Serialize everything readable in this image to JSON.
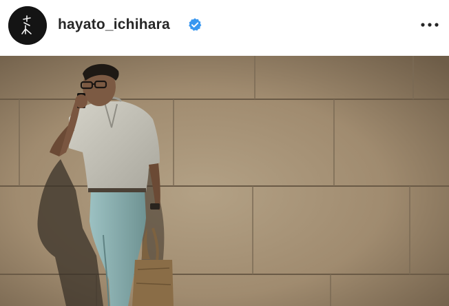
{
  "post_header": {
    "username": "hayato_ichihara",
    "verified": true,
    "avatar_icon": "calligraphy-logo-icon",
    "more_icon": "more-options-icon",
    "verified_icon": "verified-badge-icon",
    "colors": {
      "text": "#262626",
      "verified_blue": "#3897f0",
      "avatar_bg": "#141414"
    }
  },
  "post_image": {
    "description_icon": "photo",
    "colors": {
      "wall": "#a8957a",
      "wall_dark": "#5e5040",
      "shirt": "#c8c6bc",
      "pants": "#8fb3b4",
      "bag": "#8a6d47"
    }
  }
}
